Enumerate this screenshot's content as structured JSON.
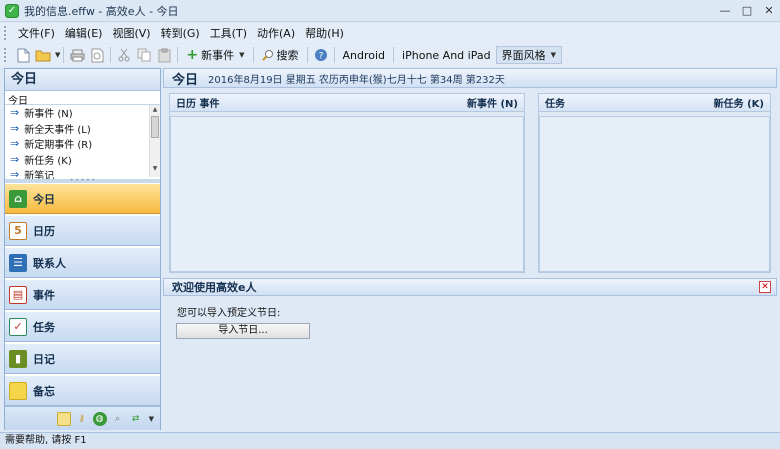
{
  "window": {
    "title": "我的信息.effw - 高效e人 - 今日",
    "app_icon_glyph": "✓",
    "minimize": "—",
    "restore": "□",
    "close": "✕"
  },
  "menu": [
    "文件(F)",
    "编辑(E)",
    "视图(V)",
    "转到(G)",
    "工具(T)",
    "动作(A)",
    "帮助(H)"
  ],
  "toolbar": {
    "new_event": "新事件",
    "search": "搜索",
    "android": "Android",
    "iphone": "iPhone And iPad",
    "theme": "界面风格"
  },
  "left": {
    "header": "今日",
    "quick_title": "今日",
    "quick_items": [
      "新事件 (N)",
      "新全天事件 (L)",
      "新定期事件 (R)",
      "新任务 (K)",
      "新笔记"
    ],
    "nav": [
      {
        "label": "今日",
        "icon": "home-icon",
        "color": "#3a9a3a"
      },
      {
        "label": "日历",
        "icon": "calendar-icon",
        "color": "#c07a2a"
      },
      {
        "label": "联系人",
        "icon": "contacts-icon",
        "color": "#2f6fb5"
      },
      {
        "label": "事件",
        "icon": "events-icon",
        "color": "#c0392b"
      },
      {
        "label": "任务",
        "icon": "tasks-icon",
        "color": "#2e8b57"
      },
      {
        "label": "日记",
        "icon": "diary-icon",
        "color": "#6b8e23"
      },
      {
        "label": "备忘",
        "icon": "memo-icon",
        "color": "#e6c229"
      }
    ]
  },
  "main": {
    "today_title": "今日",
    "date_info": "2016年8月19日 星期五 农历丙申年(猴)七月十七  第34周 第232天",
    "calendar_panel": {
      "title": "日历 事件",
      "action": "新事件 (N)"
    },
    "task_panel": {
      "title": "任务",
      "action": "新任务 (K)"
    },
    "welcome_title": "欢迎使用高效e人",
    "welcome_close": "✕",
    "welcome_text": "您可以导入预定义节日:",
    "import_button": "导入节日..."
  },
  "status": "需要帮助, 请按 F1"
}
